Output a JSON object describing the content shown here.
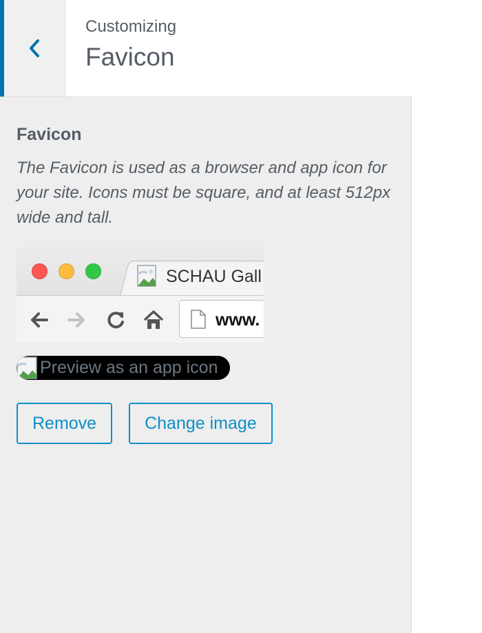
{
  "header": {
    "breadcrumb": "Customizing",
    "title": "Favicon",
    "back_icon": "chevron-left-icon"
  },
  "section": {
    "title": "Favicon",
    "description": "The Favicon is used as a browser and app icon for your site. Icons must be square, and at least 512px wide and tall."
  },
  "browser_preview": {
    "tab_title": "SCHAU Gall",
    "url": "www."
  },
  "app_preview": {
    "label": "Preview as an app icon"
  },
  "buttons": {
    "remove": "Remove",
    "change": "Change image"
  },
  "colors": {
    "accent": "#0073aa",
    "button": "#0e90c6",
    "panel_bg": "#eeeeee",
    "text": "#555d66"
  }
}
